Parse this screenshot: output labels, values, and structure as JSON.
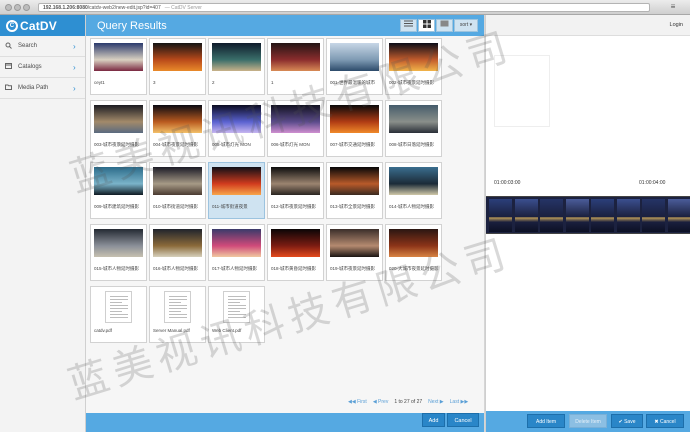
{
  "browser": {
    "url": "192.168.1.206:8080",
    "url_path": "/catdv-web2/new-edit.jsp?id=407",
    "window_title": "— CatDV Server",
    "menu_label": "≡"
  },
  "sidebar": {
    "logo_text": "CatDV",
    "items": [
      {
        "label": "Search",
        "icon": "search-icon"
      },
      {
        "label": "Catalogs",
        "icon": "catalog-icon"
      },
      {
        "label": "Media Path",
        "icon": "folder-icon"
      }
    ]
  },
  "main": {
    "title": "Query Results",
    "view_combo_label": "sort ▾",
    "items": [
      {
        "caption": "ceyt1",
        "type": "clip",
        "colors": [
          "#2b3a6c",
          "#d9d0c1",
          "#7a2740"
        ]
      },
      {
        "caption": "3",
        "type": "clip",
        "colors": [
          "#141414",
          "#b94a1a",
          "#e98a2a"
        ]
      },
      {
        "caption": "2",
        "type": "clip",
        "colors": [
          "#0f1a2b",
          "#3a6e6a",
          "#c8b28a"
        ]
      },
      {
        "caption": "1",
        "type": "clip",
        "colors": [
          "#241515",
          "#8b2d2d",
          "#d88a56"
        ]
      },
      {
        "caption": "001-世界最温暖的城市",
        "type": "clip",
        "colors": [
          "#c7d6e6",
          "#7e9ab3",
          "#2c4a6a"
        ]
      },
      {
        "caption": "002-城市夜景延时摄影",
        "type": "clip",
        "colors": [
          "#0d0d18",
          "#c25c2c",
          "#f1b44a"
        ]
      },
      {
        "caption": "003-城市夜景延时摄影",
        "type": "clip",
        "colors": [
          "#1c1c22",
          "#a28a6a",
          "#5a6a80"
        ]
      },
      {
        "caption": "004-城市夜景延时摄影",
        "type": "clip",
        "colors": [
          "#0a0a12",
          "#b95a1f",
          "#f2c06a"
        ]
      },
      {
        "caption": "005-城市灯光 MON",
        "type": "clip",
        "colors": [
          "#0b0b20",
          "#5a62d0",
          "#c7b6f0"
        ]
      },
      {
        "caption": "006-城市灯光 MON",
        "type": "clip",
        "colors": [
          "#121220",
          "#5b4b8b",
          "#cf8fd0"
        ]
      },
      {
        "caption": "007-城市交通延时摄影",
        "type": "clip",
        "colors": [
          "#0a0a0a",
          "#b03c14",
          "#f08a2a"
        ]
      },
      {
        "caption": "008-城市日落延时摄影",
        "type": "clip",
        "colors": [
          "#455c6b",
          "#8a8f8a",
          "#2a2f38"
        ]
      },
      {
        "caption": "009-城市建筑延时摄影",
        "type": "clip",
        "colors": [
          "#2b6b8a",
          "#7ab3c9",
          "#0f1a22"
        ]
      },
      {
        "caption": "010-城市街道延时摄影",
        "type": "clip",
        "colors": [
          "#1b1b26",
          "#a69a86",
          "#4a3a30"
        ]
      },
      {
        "caption": "011-城市街道夜景",
        "type": "clip",
        "selected": true,
        "colors": [
          "#0f0f16",
          "#d23c1e",
          "#f7a54a"
        ]
      },
      {
        "caption": "012-城市夜景延时摄影",
        "type": "clip",
        "colors": [
          "#0c0c0c",
          "#9b8470",
          "#2a2520"
        ]
      },
      {
        "caption": "013-城市全景延时摄影",
        "type": "clip",
        "colors": [
          "#060608",
          "#b85a2a",
          "#3a2a20"
        ]
      },
      {
        "caption": "014-城市人物延时摄影",
        "type": "clip",
        "colors": [
          "#3a6e8f",
          "#1c2b38",
          "#d0c8a8"
        ]
      },
      {
        "caption": "015-城市人物延时摄影",
        "type": "clip",
        "colors": [
          "#242a33",
          "#8a8f98",
          "#c6c0b0"
        ]
      },
      {
        "caption": "016-城市人物延时摄影",
        "type": "clip",
        "colors": [
          "#20242c",
          "#8b6a3a",
          "#d6d0bc"
        ]
      },
      {
        "caption": "017-城市人物延时摄影",
        "type": "clip",
        "colors": [
          "#3a3a6a",
          "#d04a7a",
          "#f0c8a0"
        ]
      },
      {
        "caption": "018-城市黄昏延时摄影",
        "type": "clip",
        "colors": [
          "#0a0506",
          "#7c1c12",
          "#e44a1c"
        ]
      },
      {
        "caption": "019-城市夜景延时摄影",
        "type": "clip",
        "colors": [
          "#3a2e2a",
          "#b58a70",
          "#1a1412"
        ]
      },
      {
        "caption": "020-大城市夜景延时摄影",
        "type": "clip",
        "colors": [
          "#2a1612",
          "#8c3418",
          "#d88444"
        ]
      },
      {
        "caption": "catdv.pdf",
        "type": "doc"
      },
      {
        "caption": "Server Manual.pdf",
        "type": "doc"
      },
      {
        "caption": "Web Client.pdf",
        "type": "doc"
      }
    ],
    "pager": {
      "first": "◀◀ First",
      "prev": "◀ Prev",
      "status": "1 to 27 of 27",
      "next": "Next ▶",
      "last": "Last ▶▶"
    },
    "add_label": "Add",
    "cancel_label": "Cancel"
  },
  "details": {
    "login_label": "Login",
    "timeline_start": "01:00:03:00",
    "timeline_end": "01:00:04:00",
    "add_item_label": "Add Item",
    "delete_item_label": "Delete Item",
    "save_label": "✔ Save",
    "cancel_label": "✖ Cancel"
  },
  "watermark": {
    "text": "蓝美视讯科技有限公司"
  },
  "colors": {
    "accent": "#55a9e2",
    "button": "#2a86c8",
    "sidebar_bg": "#f3f3f3",
    "selected": "#cfe3f1"
  }
}
